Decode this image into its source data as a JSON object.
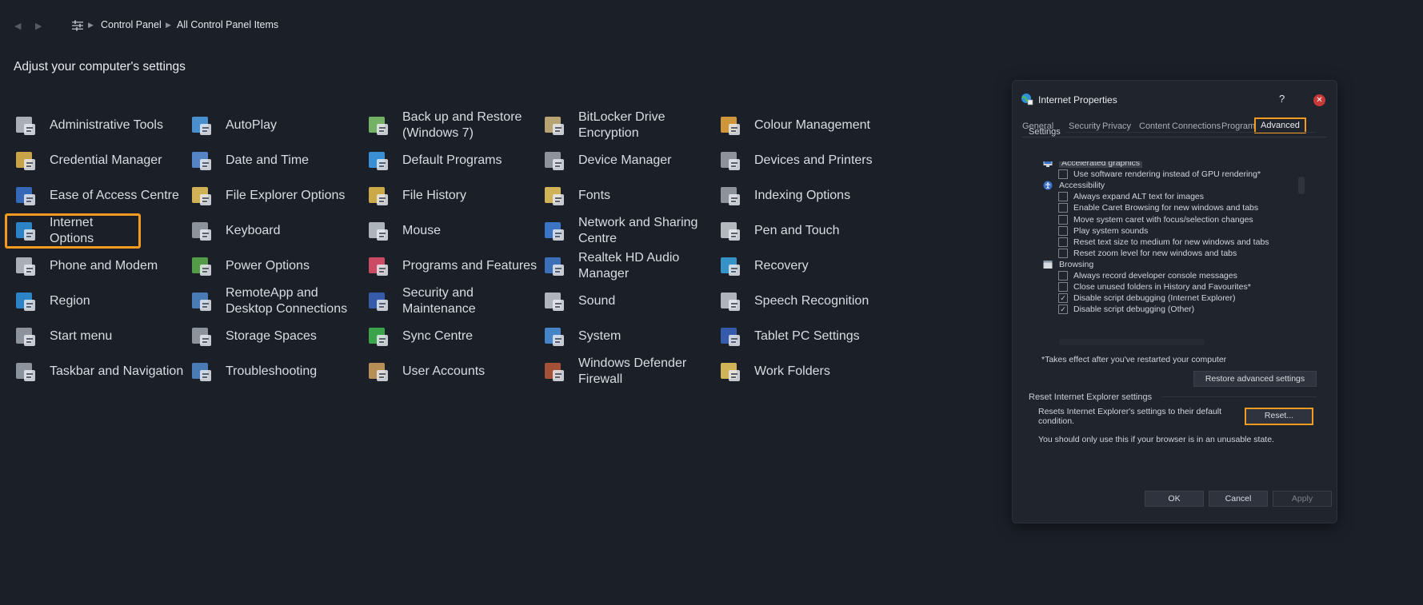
{
  "breadcrumb": {
    "root": "Control Panel",
    "current": "All Control Panel Items"
  },
  "heading": "Adjust your computer's settings",
  "items": [
    [
      "Administrative Tools",
      "AutoPlay",
      "Back up and Restore (Windows 7)",
      "BitLocker Drive Encryption",
      "Colour Management"
    ],
    [
      "Credential Manager",
      "Date and Time",
      "Default Programs",
      "Device Manager",
      "Devices and Printers"
    ],
    [
      "Ease of Access Centre",
      "File Explorer Options",
      "File History",
      "Fonts",
      "Indexing Options"
    ],
    [
      "Internet Options",
      "Keyboard",
      "Mouse",
      "Network and Sharing Centre",
      "Pen and Touch"
    ],
    [
      "Phone and Modem",
      "Power Options",
      "Programs and Features",
      "Realtek HD Audio Manager",
      "Recovery"
    ],
    [
      "Region",
      "RemoteApp and Desktop Connections",
      "Security and Maintenance",
      "Sound",
      "Speech Recognition"
    ],
    [
      "Start menu",
      "Storage Spaces",
      "Sync Centre",
      "System",
      "Tablet PC Settings"
    ],
    [
      "Taskbar and Navigation",
      "Troubleshooting",
      "User Accounts",
      "Windows Defender Firewall",
      "Work Folders"
    ]
  ],
  "highlighted_item": "Internet Options",
  "accent_color": "#f39a21",
  "dialog": {
    "title": "Internet Properties",
    "help": "?",
    "tabs": [
      "General",
      "Security",
      "Privacy",
      "Content",
      "Connections",
      "Programs",
      "Advanced"
    ],
    "active_tab": "Advanced",
    "settings_label": "Settings",
    "tree": [
      {
        "type": "group",
        "label": "Accelerated graphics",
        "icon": "monitor-icon"
      },
      {
        "type": "check",
        "label": "Use software rendering instead of GPU rendering*",
        "checked": false
      },
      {
        "type": "group",
        "label": "Accessibility",
        "icon": "accessibility-icon"
      },
      {
        "type": "check",
        "label": "Always expand ALT text for images",
        "checked": false
      },
      {
        "type": "check",
        "label": "Enable Caret Browsing for new windows and tabs",
        "checked": false
      },
      {
        "type": "check",
        "label": "Move system caret with focus/selection changes",
        "checked": false
      },
      {
        "type": "check",
        "label": "Play system sounds",
        "checked": false
      },
      {
        "type": "check",
        "label": "Reset text size to medium for new windows and tabs",
        "checked": false
      },
      {
        "type": "check",
        "label": "Reset zoom level for new windows and tabs",
        "checked": false
      },
      {
        "type": "group",
        "label": "Browsing",
        "icon": "window-icon"
      },
      {
        "type": "check",
        "label": "Always record developer console messages",
        "checked": false
      },
      {
        "type": "check",
        "label": "Close unused folders in History and Favourites*",
        "checked": false
      },
      {
        "type": "check",
        "label": "Disable script debugging (Internet Explorer)",
        "checked": true
      },
      {
        "type": "check",
        "label": "Disable script debugging (Other)",
        "checked": true
      }
    ],
    "restart_note": "*Takes effect after you've restarted your computer",
    "restore_button": "Restore advanced settings",
    "reset_section": "Reset Internet Explorer settings",
    "reset_desc": "Resets Internet Explorer's settings to their default condition.",
    "reset_button": "Reset...",
    "reset_warning": "You should only use this if your browser is in an unusable state.",
    "ok": "OK",
    "cancel": "Cancel",
    "apply": "Apply"
  }
}
